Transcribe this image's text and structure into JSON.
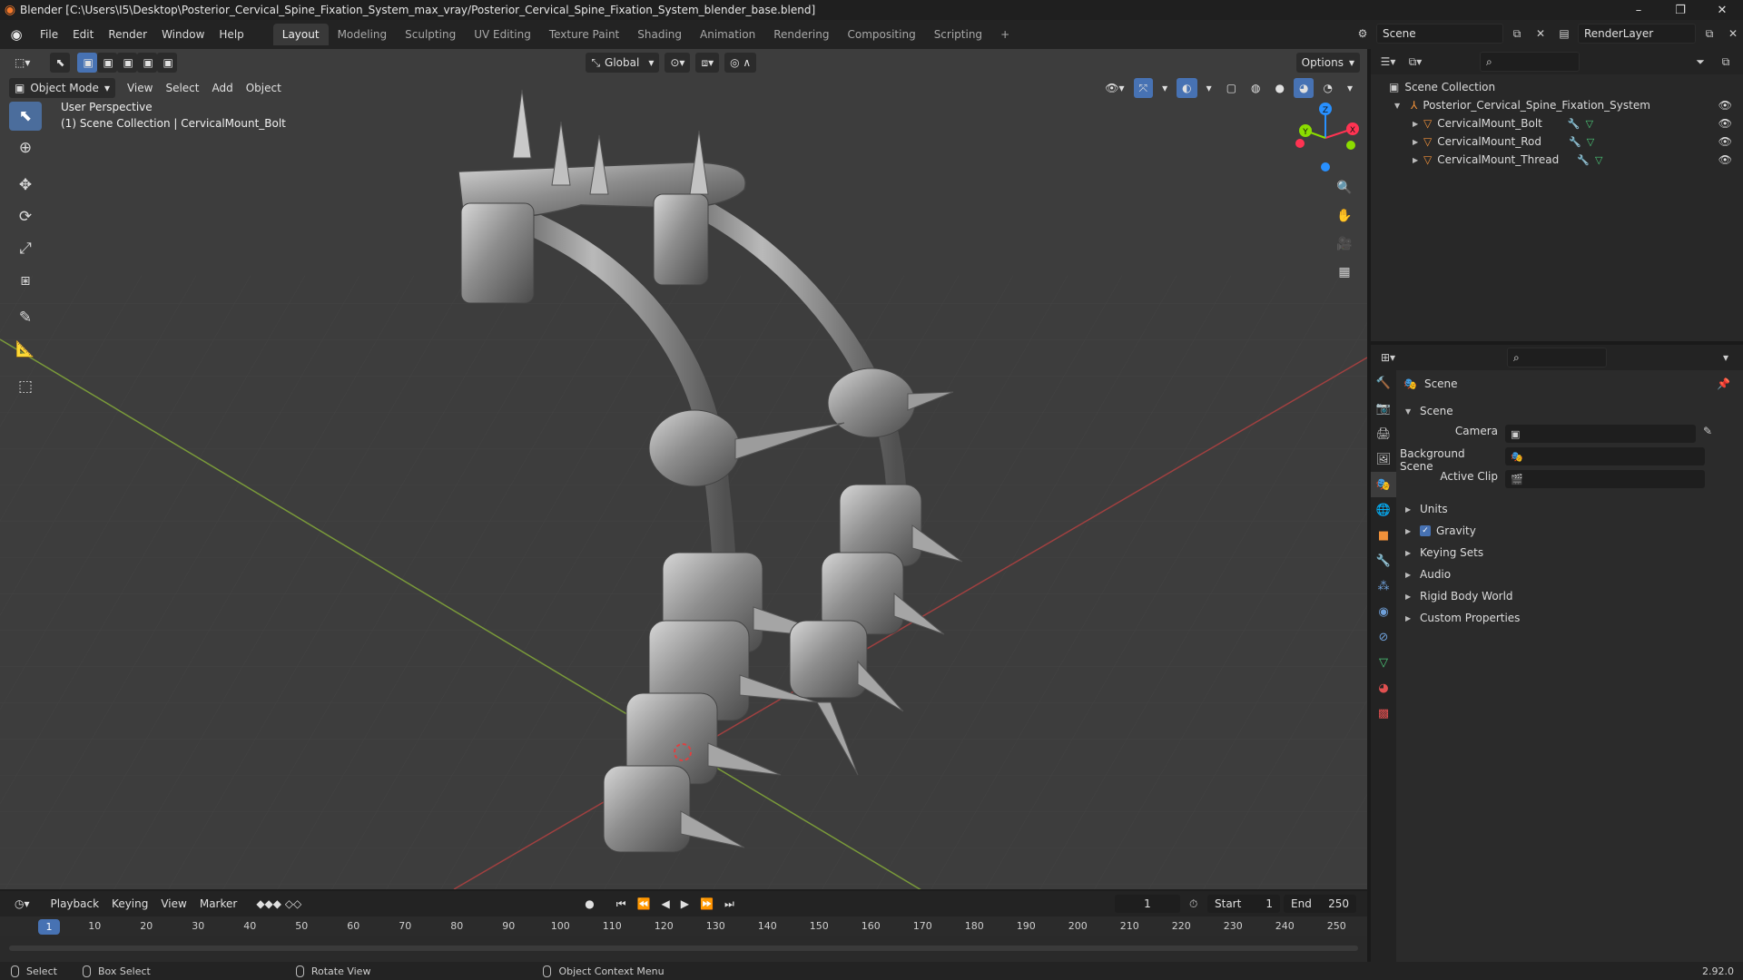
{
  "window": {
    "title": "Blender [C:\\Users\\I5\\Desktop\\Posterior_Cervical_Spine_Fixation_System_max_vray/Posterior_Cervical_Spine_Fixation_System_blender_base.blend]",
    "controls": [
      "–",
      "❐",
      "✕"
    ]
  },
  "menus": [
    "File",
    "Edit",
    "Render",
    "Window",
    "Help"
  ],
  "workspaces": [
    {
      "label": "Layout",
      "active": true
    },
    {
      "label": "Modeling"
    },
    {
      "label": "Sculpting"
    },
    {
      "label": "UV Editing"
    },
    {
      "label": "Texture Paint"
    },
    {
      "label": "Shading"
    },
    {
      "label": "Animation"
    },
    {
      "label": "Rendering"
    },
    {
      "label": "Compositing"
    },
    {
      "label": "Scripting"
    }
  ],
  "topright": {
    "scene_label": "Scene",
    "render_layer_label": "RenderLayer"
  },
  "viewport": {
    "mode": "Object Mode",
    "menus": [
      "View",
      "Select",
      "Add",
      "Object"
    ],
    "transform_orientation": "Global",
    "options_label": "Options",
    "info_line1": "User Perspective",
    "info_line2": "(1) Scene Collection | CervicalMount_Bolt",
    "gizmo": {
      "x": "X",
      "y": "Y",
      "z": "Z"
    }
  },
  "timeline": {
    "menus": [
      "Playback",
      "Keying",
      "View",
      "Marker"
    ],
    "current_frame": "1",
    "start_label": "Start",
    "start_value": "1",
    "end_label": "End",
    "end_value": "250",
    "ticks": [
      "10",
      "20",
      "30",
      "40",
      "50",
      "60",
      "70",
      "80",
      "90",
      "100",
      "110",
      "120",
      "130",
      "140",
      "150",
      "160",
      "170",
      "180",
      "190",
      "200",
      "210",
      "220",
      "230",
      "240",
      "250"
    ],
    "playhead_label": "1"
  },
  "statusbar": {
    "hints": [
      "Select",
      "Box Select",
      "Rotate View",
      "Object Context Menu"
    ],
    "version": "2.92.0"
  },
  "outliner": {
    "root": "Scene Collection",
    "collection": "Posterior_Cervical_Spine_Fixation_System",
    "objects": [
      "CervicalMount_Bolt",
      "CervicalMount_Rod",
      "CervicalMount_Thread"
    ]
  },
  "properties": {
    "context_title": "Scene",
    "panel_title": "Scene",
    "fields": [
      {
        "label": "Camera",
        "value": ""
      },
      {
        "label": "Background Scene",
        "value": ""
      },
      {
        "label": "Active Clip",
        "value": ""
      }
    ],
    "subpanels": [
      "Units",
      "Gravity",
      "Keying Sets",
      "Audio",
      "Rigid Body World",
      "Custom Properties"
    ]
  },
  "colors": {
    "accent": "#4772b3",
    "object_orange": "#f0913a",
    "mesh_green": "#4cc979",
    "x_axis": "#ff3352",
    "y_axis": "#8bdc00",
    "z_axis": "#2890ff"
  }
}
